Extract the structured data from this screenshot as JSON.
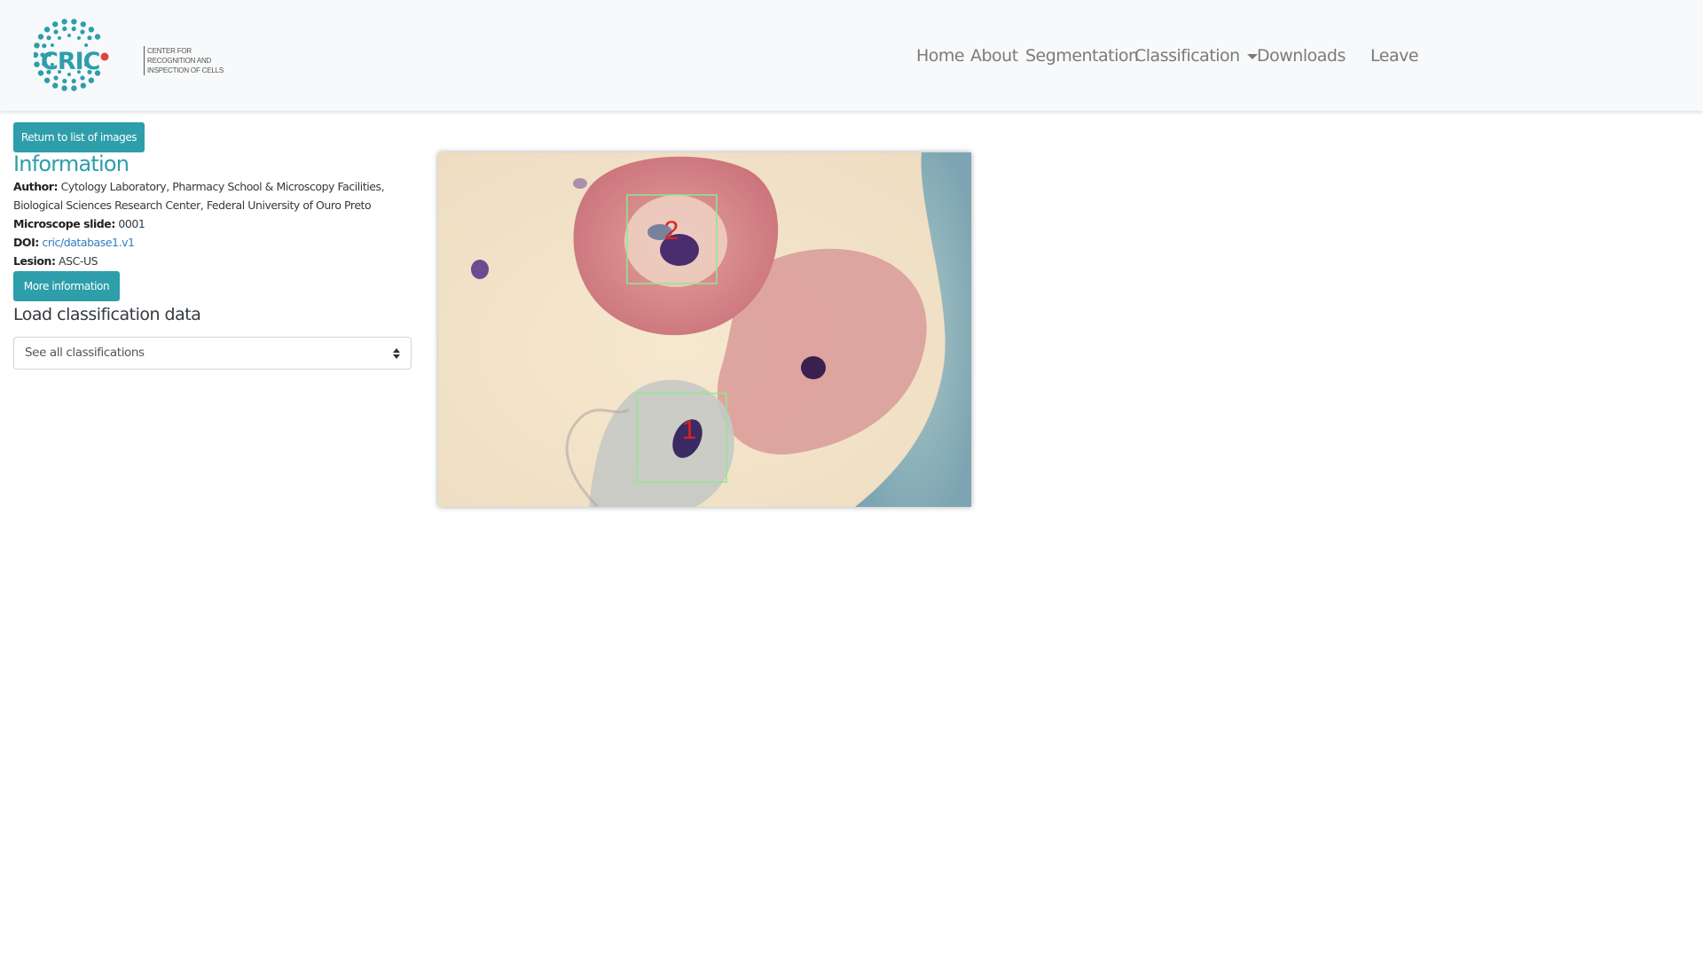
{
  "brand": {
    "logo_text": "CRIC",
    "tagline": "Center for recognition and inspection of cells"
  },
  "nav": {
    "items": [
      {
        "label": "Home"
      },
      {
        "label": "About"
      },
      {
        "label": "Segmentation"
      },
      {
        "label": "Classification"
      },
      {
        "label": "Downloads"
      },
      {
        "label": "Leave"
      }
    ]
  },
  "sidebar": {
    "return_button": "Return to list of images",
    "info_title": "Information",
    "author_label": "Author:",
    "author_value": "Cytology Laboratory, Pharmacy School & Microscopy Facilities, Biological Sciences Research Center, Federal University of Ouro Preto",
    "slide_label": "Microscope slide:",
    "slide_value": "0001",
    "doi_label": "DOI:",
    "doi_value": "cric/database1.v1",
    "lesion_label": "Lesion:",
    "lesion_value": "ASC-US",
    "more_button": "More information",
    "load_title": "Load classification data",
    "select_value": "See all classifications"
  },
  "viewer": {
    "annotations": [
      {
        "label": "2"
      },
      {
        "label": "1"
      }
    ],
    "colors": {
      "box": "#90e890",
      "label": "#e02020",
      "accent": "#2e9eab"
    }
  }
}
